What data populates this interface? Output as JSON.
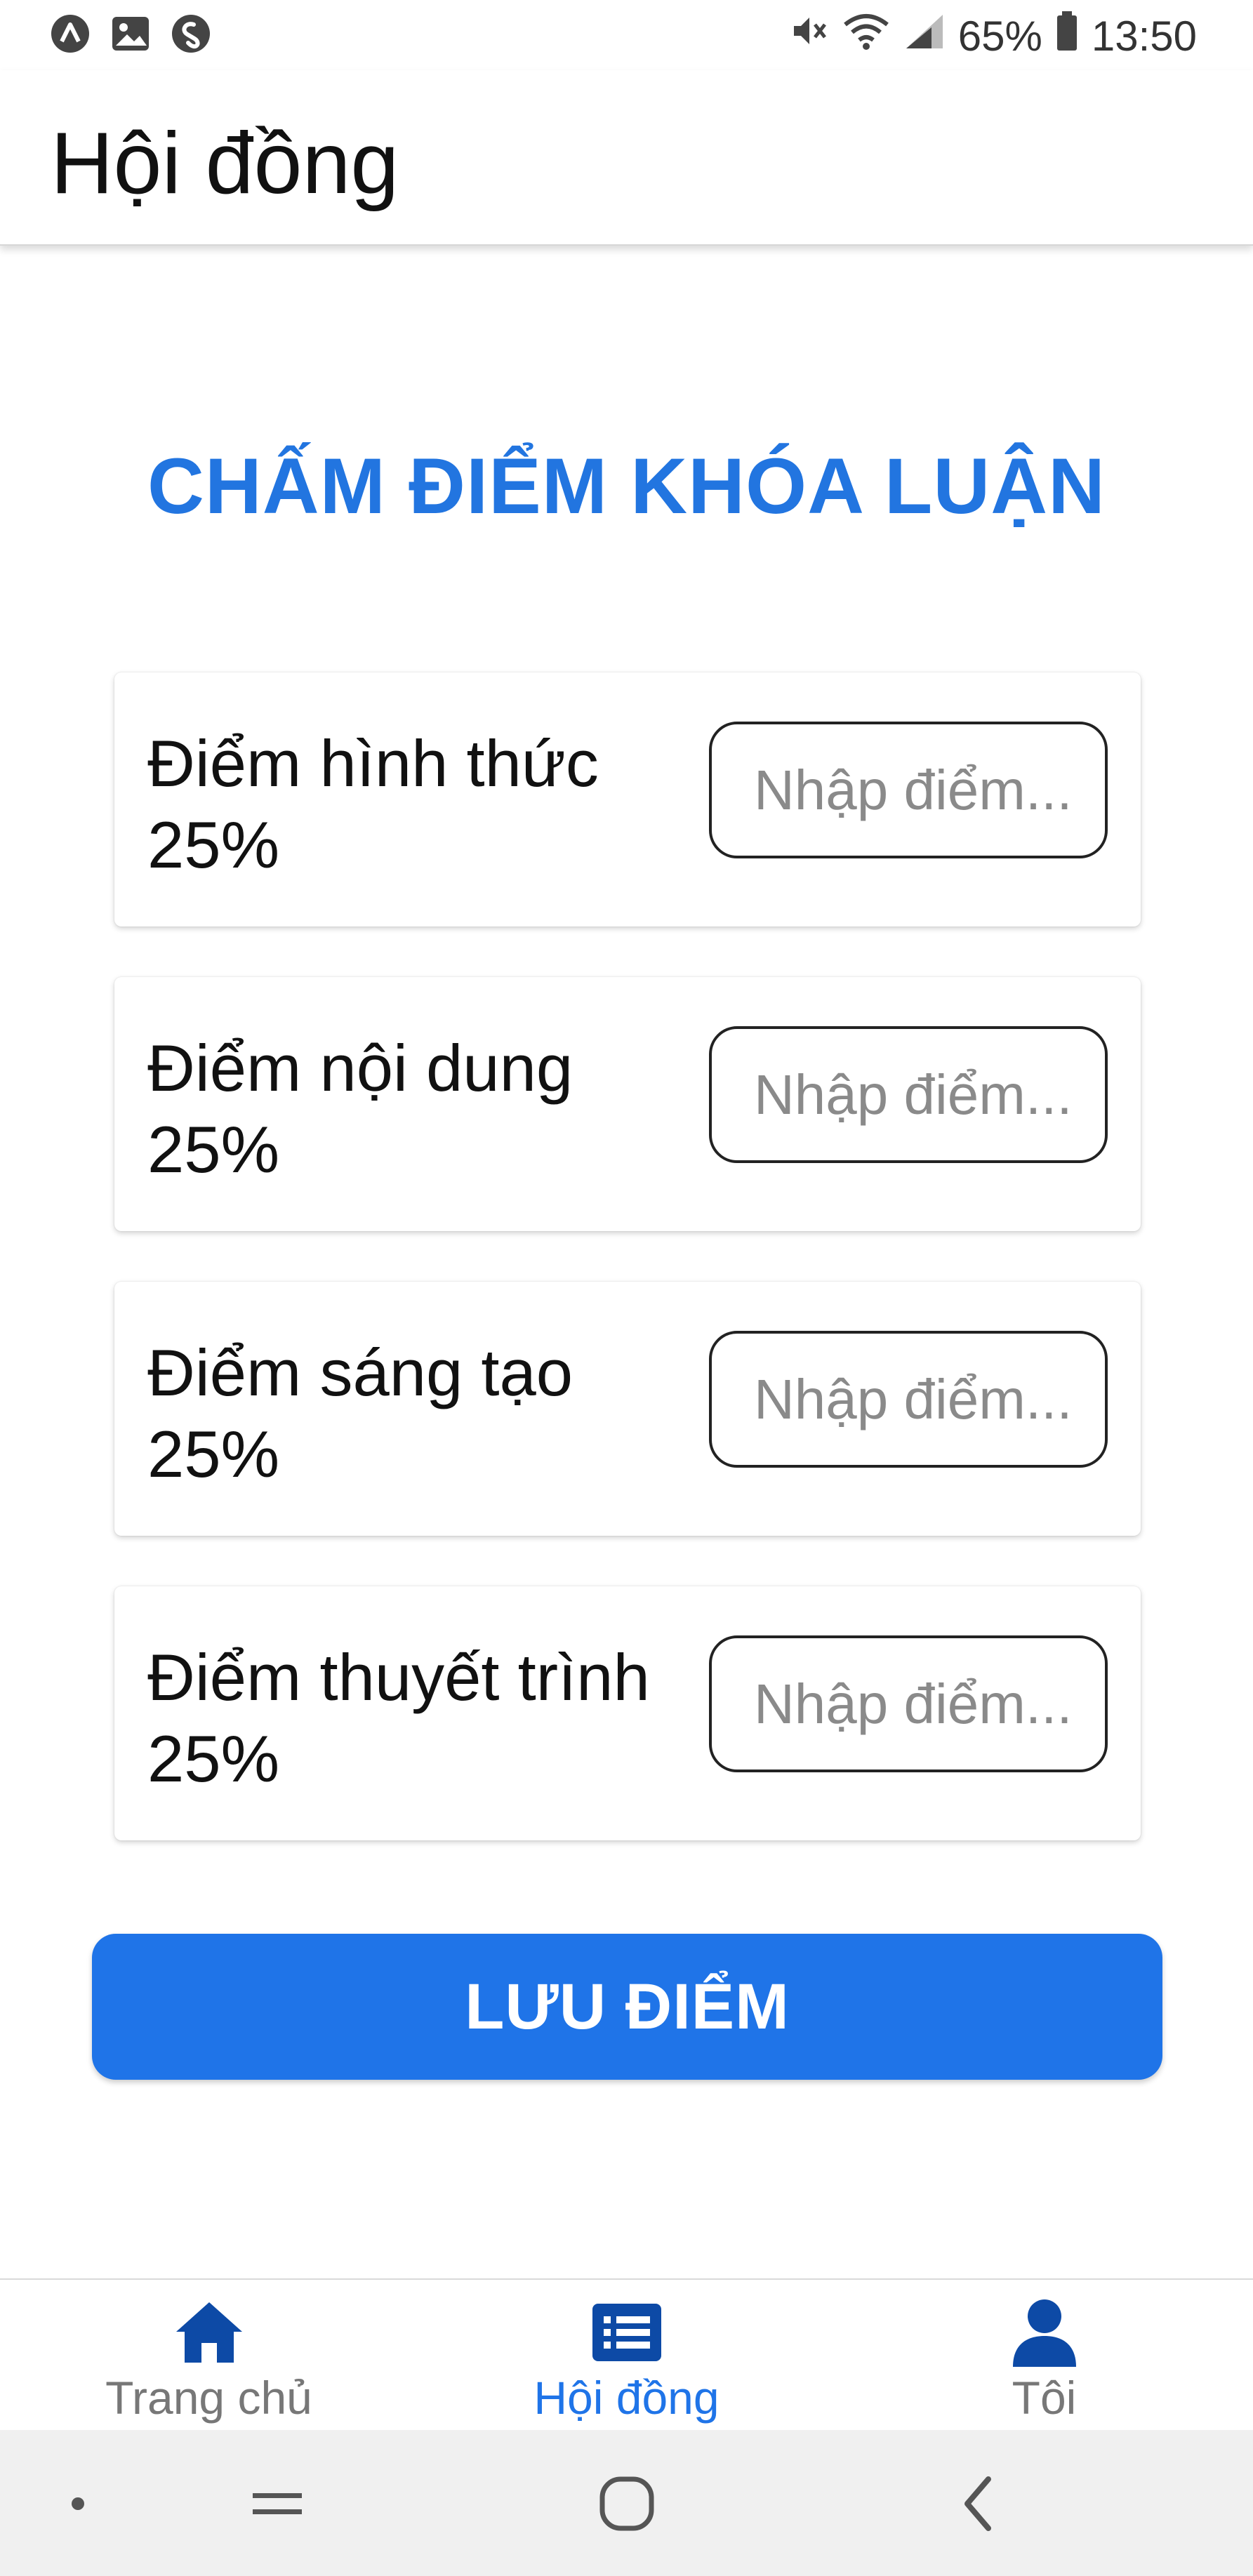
{
  "status_bar": {
    "battery_percent": "65%",
    "time": "13:50",
    "left_icons": [
      "app-a-icon",
      "gallery-icon",
      "shazam-icon"
    ],
    "right_icons": [
      "mute-icon",
      "wifi-icon",
      "signal-icon",
      "battery-icon"
    ]
  },
  "header": {
    "title": "Hội đồng"
  },
  "main": {
    "title": "CHẤM ĐIỂM KHÓA LUẬN",
    "criteria": [
      {
        "label": "Điểm hình thức",
        "weight": "25%",
        "placeholder": "Nhập điểm..."
      },
      {
        "label": "Điểm nội dung",
        "weight": "25%",
        "placeholder": "Nhập điểm..."
      },
      {
        "label": "Điểm sáng tạo",
        "weight": "25%",
        "placeholder": "Nhập điểm..."
      },
      {
        "label": "Điểm thuyết trình",
        "weight": "25%",
        "placeholder": "Nhập điểm..."
      }
    ],
    "save_label": "LƯU ĐIỂM"
  },
  "tabs": [
    {
      "label": "Trang chủ",
      "icon": "home-icon",
      "active": false
    },
    {
      "label": "Hội đồng",
      "icon": "list-icon",
      "active": true
    },
    {
      "label": "Tôi",
      "icon": "user-icon",
      "active": false
    }
  ],
  "colors": {
    "accent": "#1f74e8",
    "title_blue": "#2275e0",
    "tab_icon_dark": "#0d4aa6",
    "inactive_text": "#777777"
  }
}
